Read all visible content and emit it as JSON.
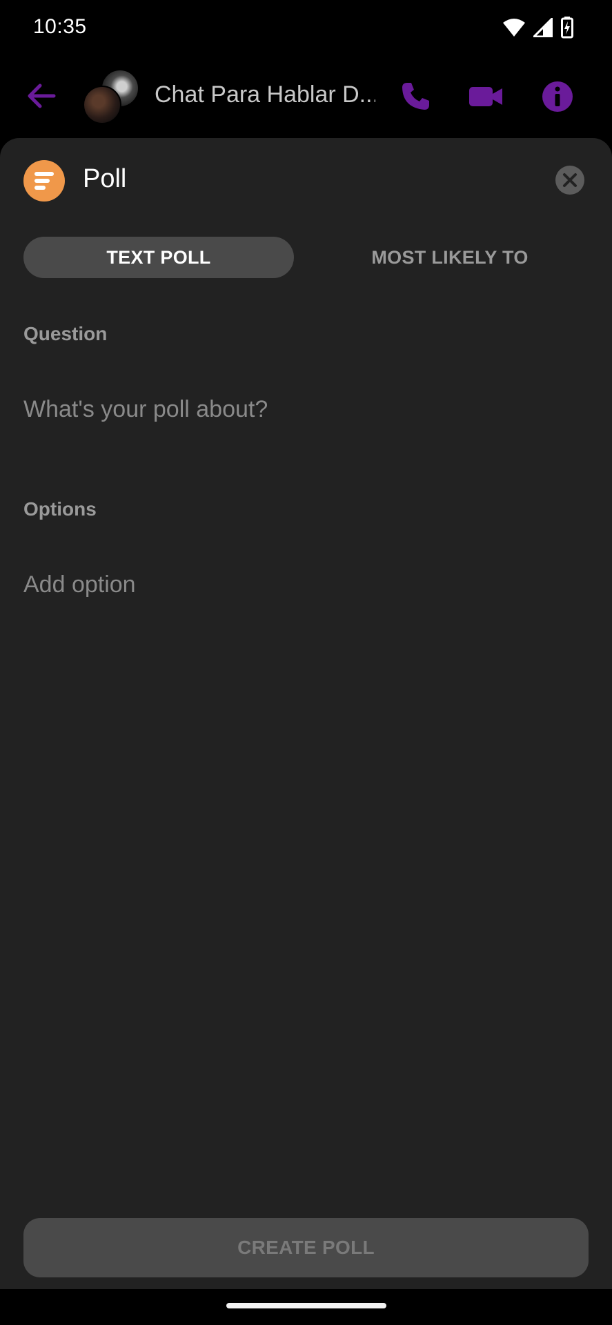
{
  "status_bar": {
    "time": "10:35",
    "icons": [
      "wifi-icon",
      "signal-icon",
      "battery-charging-icon"
    ]
  },
  "chat_header": {
    "title": "Chat Para Hablar D...",
    "accent_color": "#7b1fa2",
    "icons": [
      "back-arrow-icon",
      "phone-icon",
      "video-icon",
      "info-icon"
    ]
  },
  "sheet": {
    "title": "Poll",
    "badge_color": "#f0984a",
    "tabs": [
      {
        "label": "TEXT POLL",
        "active": true
      },
      {
        "label": "MOST LIKELY TO",
        "active": false
      }
    ],
    "question_label": "Question",
    "question_placeholder": "What's your poll about?",
    "options_label": "Options",
    "option_placeholder": "Add option",
    "create_button": "CREATE POLL"
  }
}
